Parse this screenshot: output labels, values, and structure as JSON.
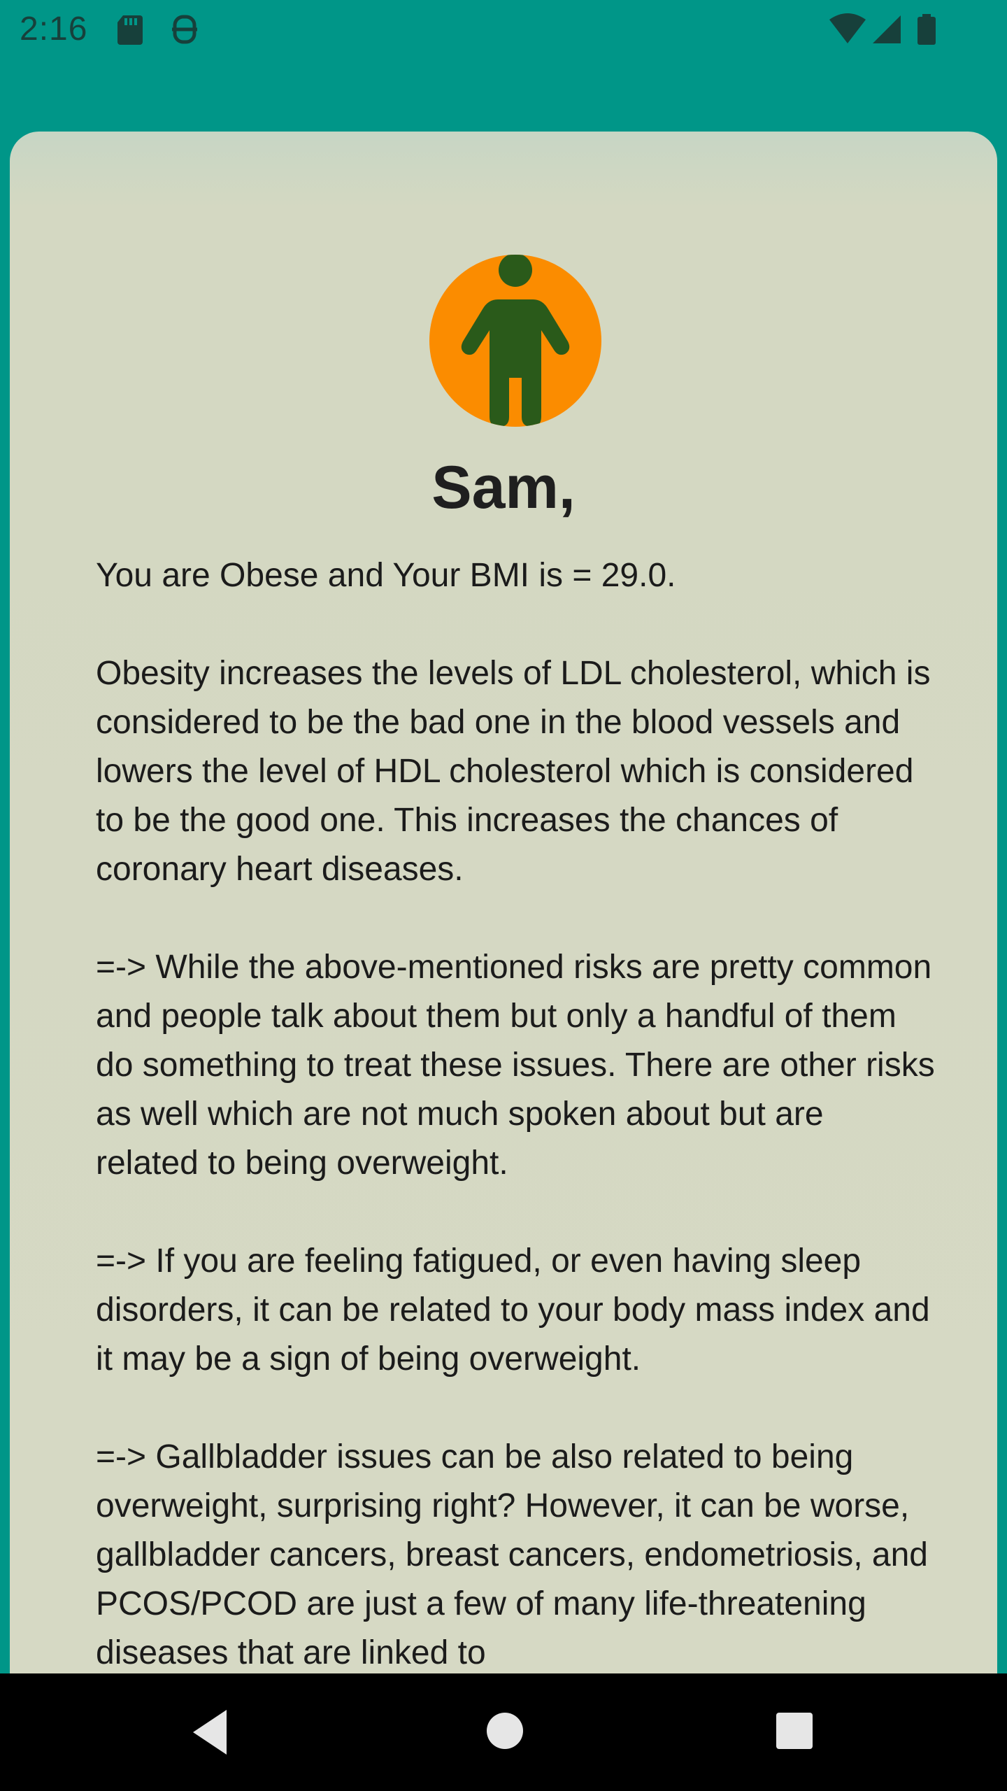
{
  "status_bar": {
    "time": "2:16",
    "left_icons": [
      "sd-card-icon",
      "screenshot-icon"
    ],
    "right_icons": [
      "wifi-icon",
      "cellular-signal-icon",
      "battery-icon"
    ]
  },
  "colors": {
    "app_bar": "#009688",
    "card_background": "#d6d9c4",
    "avatar_background": "#fb8c00",
    "avatar_figure": "#2a5a1a",
    "text": "#1b1b1b"
  },
  "profile": {
    "avatar_icon": "person-icon",
    "name": "Sam,"
  },
  "result": {
    "text": "You are Obese and Your BMI is = 29.0.\n\nObesity increases the levels of LDL cholesterol, which is considered to be the bad one in the blood vessels and lowers the level of HDL cholesterol which is considered to be the good one. This increases the chances of coronary heart diseases.\n\n=-> While the above-mentioned risks are pretty common and people talk about them but only a handful of them do something to treat these issues. There are other risks as well which are not much spoken about but are related to being overweight.\n\n=-> If you are feeling fatigued, or even having sleep disorders, it can be related to your body mass index and it may be a sign of being overweight.\n\n=-> Gallbladder issues can be also related to being overweight, surprising right? However, it can be worse, gallbladder cancers, breast cancers, endometriosis, and PCOS/PCOD are just a few of many life-threatening diseases that are linked to"
  },
  "navigation": {
    "buttons": [
      "back-icon",
      "home-icon",
      "recents-icon"
    ]
  }
}
